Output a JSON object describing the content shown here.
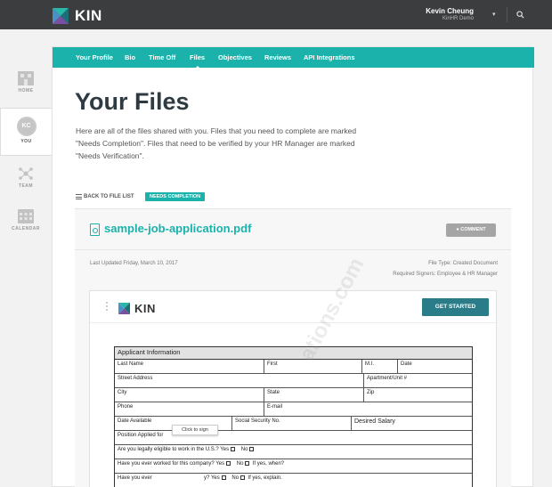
{
  "app": {
    "logo_text": "KIN"
  },
  "header": {
    "user_name": "Kevin Cheung",
    "company": "KinHR Demo",
    "caret": "▾"
  },
  "sidebar": {
    "items": [
      {
        "label": "HOME",
        "icon": "home-icon"
      },
      {
        "label": "YOU",
        "icon": "avatar-icon",
        "initials": "KC",
        "active": true
      },
      {
        "label": "TEAM",
        "icon": "team-icon"
      },
      {
        "label": "CALENDAR",
        "icon": "calendar-icon"
      }
    ]
  },
  "tabs": [
    {
      "label": "Your Profile"
    },
    {
      "label": "Bio"
    },
    {
      "label": "Time Off"
    },
    {
      "label": "Files",
      "active": true
    },
    {
      "label": "Objectives"
    },
    {
      "label": "Reviews"
    },
    {
      "label": "API Integrations"
    }
  ],
  "page": {
    "title": "Your Files",
    "intro": "Here are all of the files shared with you. Files that you need to complete are marked \"Needs Completion\". Files that need to be verified by your HR Manager are marked \"Needs Verification\".",
    "back_link": "BACK TO FILE LIST",
    "status_badge": "NEEDS COMPLETION"
  },
  "file": {
    "name": "sample-job-application.pdf",
    "comment_button": "COMMENT",
    "updated": "Last Updated Friday, March 10, 2017",
    "file_type": "File Type: Created Document",
    "signers": "Required Signers: Employee & HR Manager"
  },
  "viewer": {
    "logo_text": "KIN",
    "get_started": "GET STARTED",
    "tooltip": "Click to sign",
    "watermark": "ations.com"
  },
  "form": {
    "title": "Applicant Information",
    "rows": [
      [
        "Last Name",
        "First",
        "M.I.",
        "Date"
      ],
      [
        "Street Address",
        "Apartment/Unit #"
      ],
      [
        "City",
        "State",
        "Zip"
      ],
      [
        "Phone",
        "E-mail"
      ],
      [
        "Date Available",
        "Social Security No.",
        "Desired Salary"
      ],
      [
        "Position Applied for"
      ]
    ],
    "q1": "Are you legally  eligible to work in the U.S.?",
    "q2": "Have you ever worked for this company?",
    "q2_followup": "If yes, when?",
    "q3": "Have you ever",
    "q3_tail": "y?",
    "q3_followup": "If yes, explain.",
    "yes": "Yes",
    "no": "No"
  },
  "colors": {
    "accent": "#1ab2ab",
    "topbar": "#3b3d3f",
    "button_dark": "#2a7d88"
  }
}
